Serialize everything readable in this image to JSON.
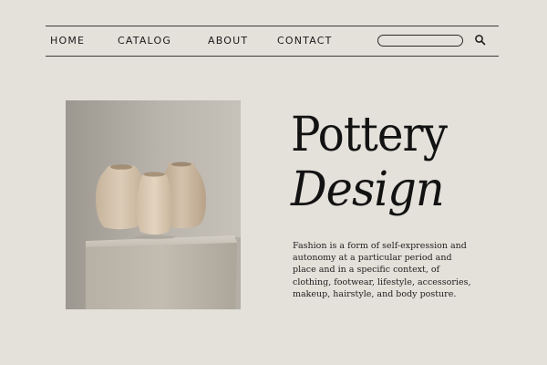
{
  "nav": {
    "items": [
      {
        "label": "HOME"
      },
      {
        "label": "CATALOG"
      },
      {
        "label": "ABOUT"
      },
      {
        "label": "CONTACT"
      }
    ],
    "search": {
      "value": "",
      "placeholder": ""
    }
  },
  "icons": {
    "search": "search-icon"
  },
  "hero": {
    "title_line1": "Pottery",
    "title_line2": "Design",
    "body": "Fashion is a form of self-expression and autonomy at a particular period and place and in a specific context, of clothing, footwear, lifestyle, accessories, makeup, hairstyle, and body posture."
  },
  "colors": {
    "background": "#e4e1da",
    "text": "#141414",
    "rule": "#3a3a3a"
  }
}
